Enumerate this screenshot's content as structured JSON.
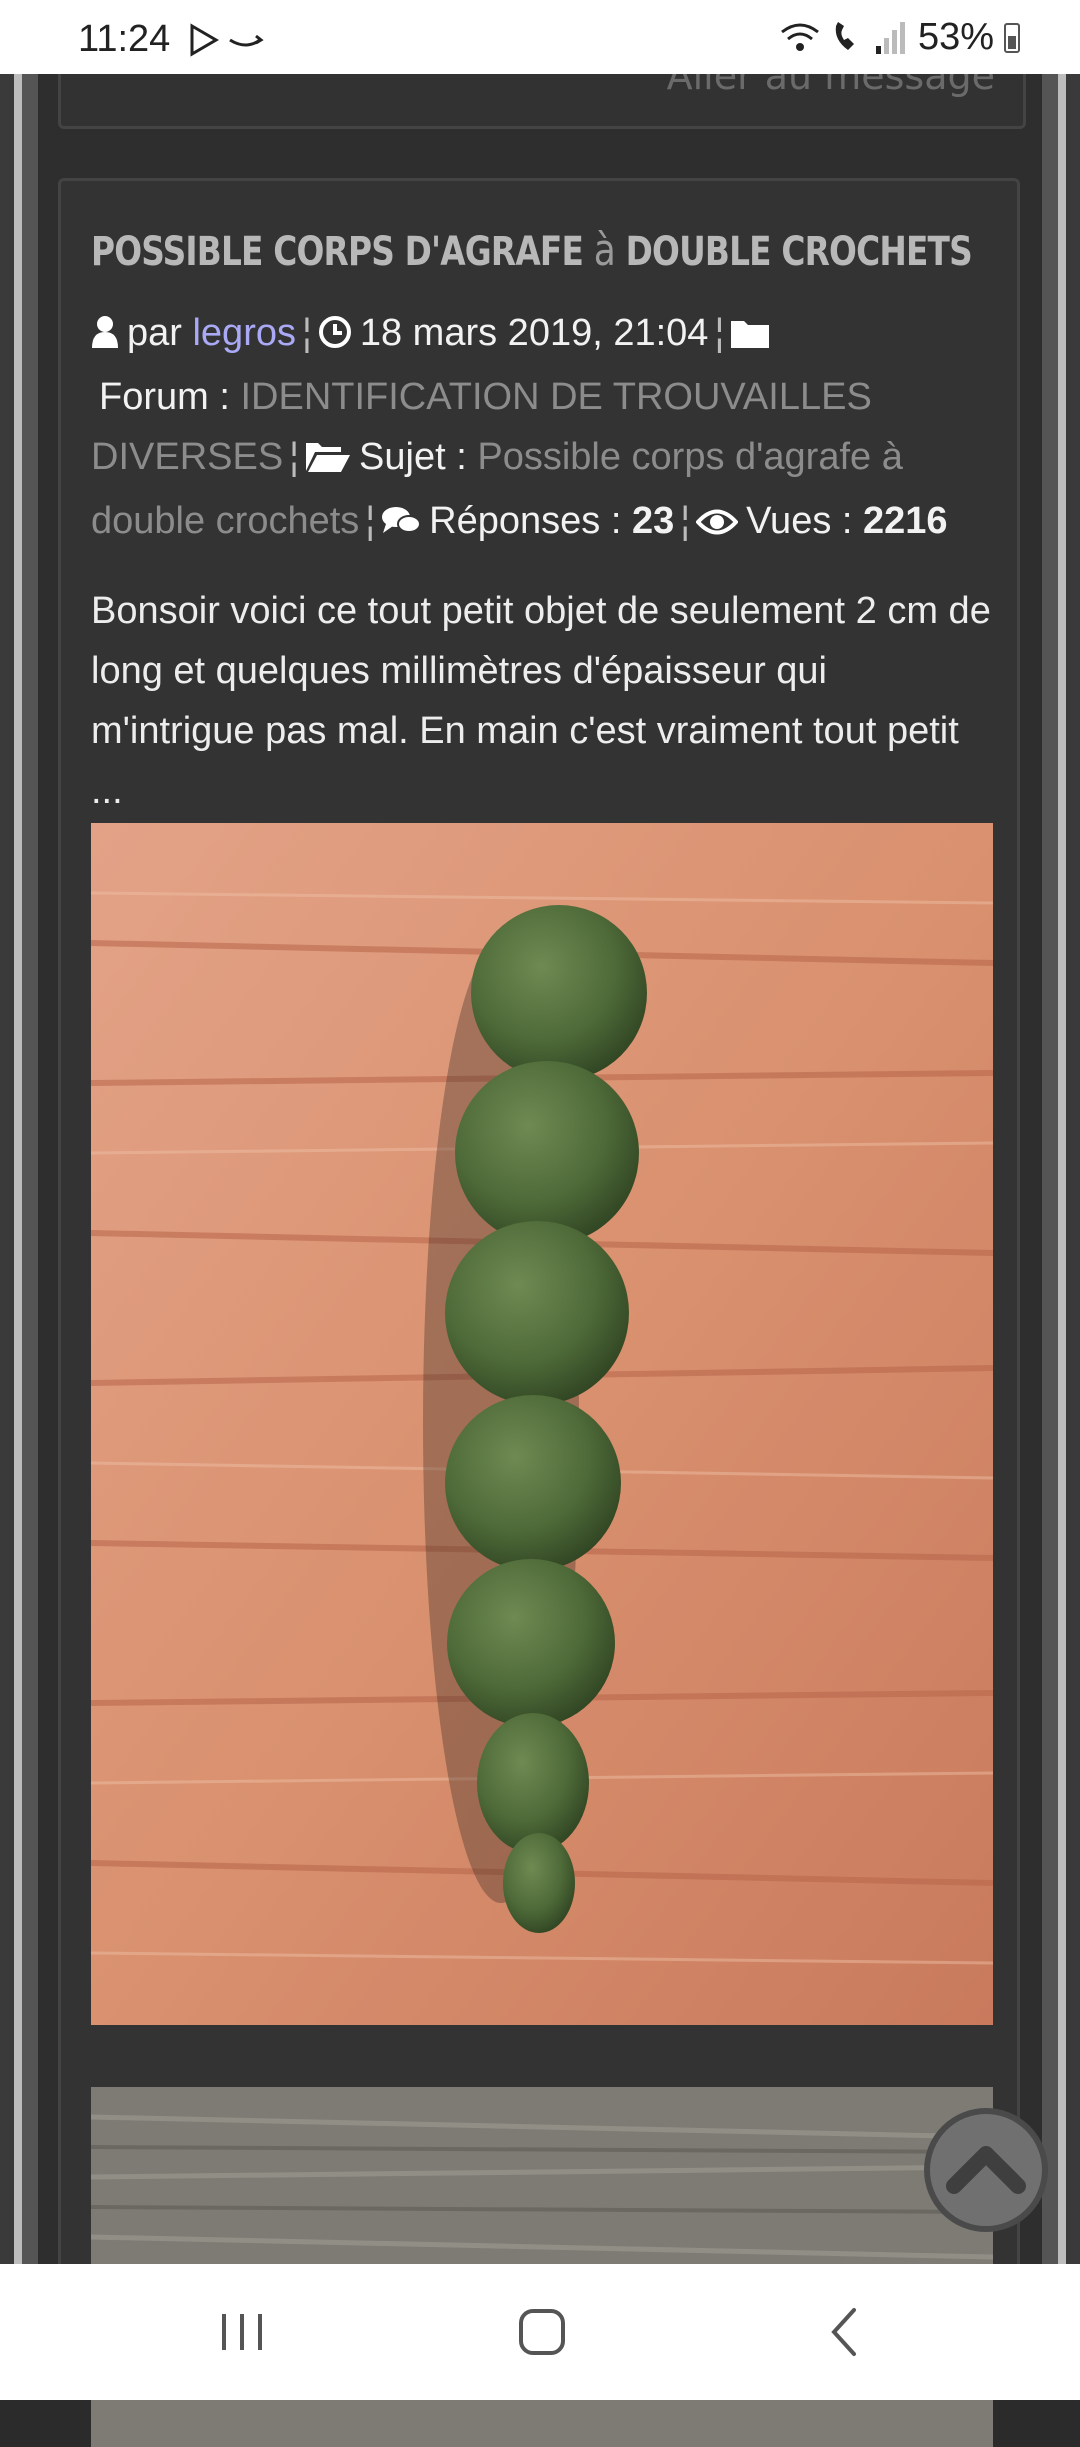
{
  "status_bar": {
    "time": "11:24",
    "battery": "53%",
    "icons": [
      "play-store-icon",
      "amazon-icon",
      "wifi-calling-icon",
      "volte-icon",
      "signal-icon",
      "battery-icon"
    ]
  },
  "previous_post": {
    "link_text": "Aller au message"
  },
  "post": {
    "title_part1": "POSSIBLE CORPS D'AGRAFE",
    "title_part2": "à",
    "title_part3": "DOUBLE CROCHETS",
    "meta": {
      "by_label": "par",
      "author": "legros",
      "date": "18 mars 2019, 21:04",
      "forum_label": "Forum :",
      "forum_name": "IDENTIFICATION DE TROUVAILLES DIVERSES",
      "subject_label": "Sujet :",
      "subject_name": "Possible corps d'agrafe à double crochets",
      "replies_label": "Réponses :",
      "replies_count": "23",
      "views_label": "Vues :",
      "views_count": "2216"
    },
    "body": "Bonsoir voici ce tout petit objet de seulement 2 cm de long et quelques millimètres d'épaisseur qui m'intrigue pas mal. En main c'est vraiment tout petit ..."
  },
  "colors": {
    "author_link": "#a9a9f5",
    "muted_link": "#8c8c8c",
    "card_bg": "#333333"
  },
  "nav_bar": {
    "icons": [
      "recent-apps-icon",
      "home-icon",
      "back-icon"
    ]
  }
}
